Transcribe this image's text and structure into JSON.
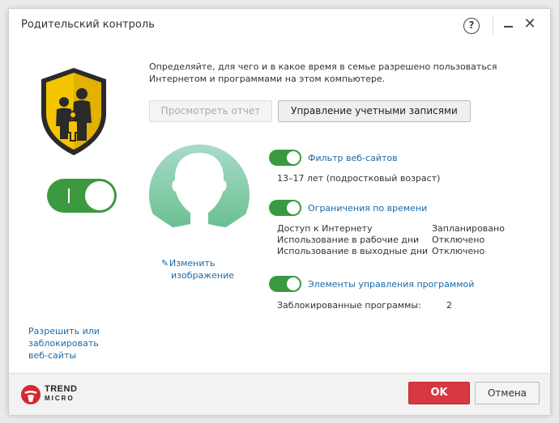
{
  "window": {
    "title": "Родительский контроль",
    "help_label": "?",
    "close_label": "✕"
  },
  "main": {
    "description_line1": "Определяйте, для чего и в какое время в семье разрешено пользоваться",
    "description_line2": "Интернетом и программами на этом компьютере.",
    "buttons": {
      "view_report": "Просмотреть отчет",
      "manage_accounts": "Управление учетными записями"
    },
    "master_toggle": {
      "state": "on",
      "on_mark": "I"
    },
    "edit_image": {
      "line1": "Изменить",
      "line2": "изображение"
    }
  },
  "filters": {
    "web": {
      "label": "Фильтр веб-сайтов",
      "state": "on",
      "detail": "13–17 лет (подростковый возраст)"
    },
    "time": {
      "label": "Ограничения по времени",
      "state": "on",
      "rows": [
        {
          "name": "Доступ к Интернету",
          "value": "Запланировано"
        },
        {
          "name": "Использование в рабочие дни",
          "value": "Отключено"
        },
        {
          "name": "Использование в выходные дни",
          "value": "Отключено"
        }
      ]
    },
    "apps": {
      "label": "Элементы управления программой",
      "state": "on",
      "blocked_label": "Заблокированные программы:",
      "blocked_count": "2"
    }
  },
  "sidebar": {
    "allow_block_line1": "Разрешить или",
    "allow_block_line2": "заблокировать",
    "allow_block_line3": "веб-сайты"
  },
  "footer": {
    "logo_line1": "TREND",
    "logo_line2": "MICRO",
    "ok_label": "OK",
    "cancel_label": "Отмена"
  },
  "colors": {
    "accent_green": "#3b9a3f",
    "link_blue": "#1a6aa8",
    "ok_red": "#d83840",
    "avatar_teal": "#8fd0b8",
    "shield_yellow": "#f5c400"
  }
}
